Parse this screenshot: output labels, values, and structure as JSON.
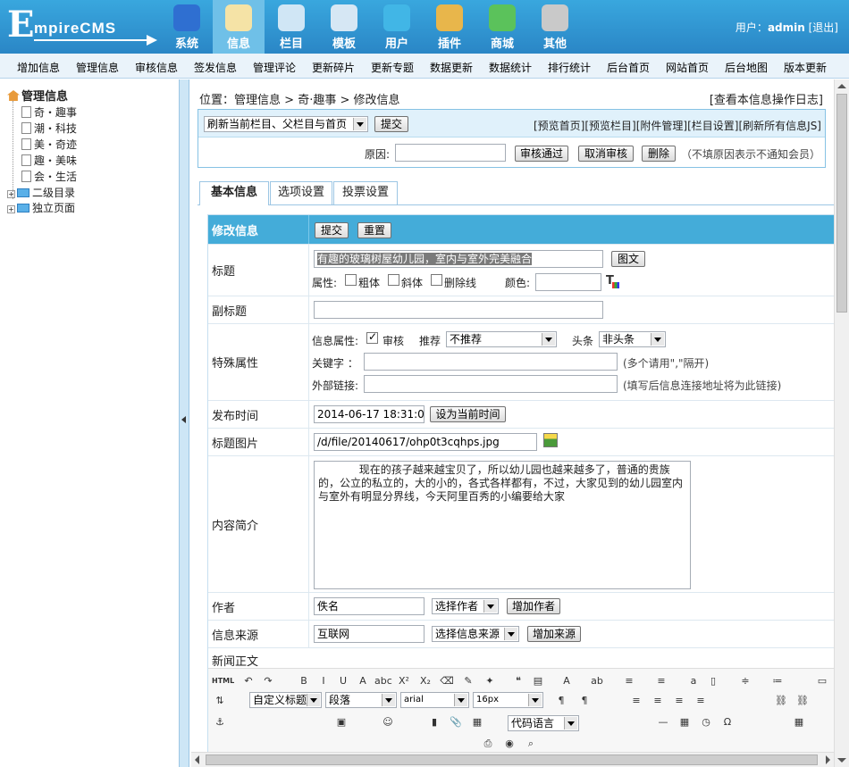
{
  "logo": {
    "big": "E",
    "rest": "mpireCMS"
  },
  "nav": [
    {
      "label": "系统",
      "icon": "globe-icon",
      "color": "#2f6fd1"
    },
    {
      "label": "信息",
      "icon": "edit-document-icon",
      "color": "#f5e3a6",
      "active": true
    },
    {
      "label": "栏目",
      "icon": "folder-icon",
      "color": "#d0e6f5"
    },
    {
      "label": "模板",
      "icon": "template-window-icon",
      "color": "#d6e7f4"
    },
    {
      "label": "用户",
      "icon": "user-icon",
      "color": "#41b6e6"
    },
    {
      "label": "插件",
      "icon": "tools-icon",
      "color": "#e8b64b"
    },
    {
      "label": "商城",
      "icon": "credit-card-icon",
      "color": "#5bc25b"
    },
    {
      "label": "其他",
      "icon": "gear-icon",
      "color": "#c9c9c9"
    }
  ],
  "user": {
    "prefix": "用户：",
    "name": "admin",
    "logout": "[退出]"
  },
  "menu": [
    "增加信息",
    "管理信息",
    "审核信息",
    "签发信息",
    "管理评论",
    "更新碎片",
    "更新专题",
    "数据更新",
    "数据统计",
    "排行统计",
    "后台首页",
    "网站首页",
    "后台地图",
    "版本更新"
  ],
  "tree": {
    "root": "管理信息",
    "items": [
      "奇・趣事",
      "潮・科技",
      "美・奇迹",
      "趣・美味",
      "会・生活"
    ],
    "folders": [
      "二级目录",
      "独立页面"
    ]
  },
  "breadcrumb": {
    "prefix": "位置：",
    "a": "管理信息",
    "sep1": " > ",
    "b": "奇·趣事",
    "sep2": " > ",
    "c": "修改信息"
  },
  "log_link": "[查看本信息操作日志]",
  "refresh_select": "刷新当前栏目、父栏目与首页",
  "submit_btn": "提交",
  "top_links": [
    "[预览首页]",
    "[预览栏目]",
    "[附件管理]",
    "[栏目设置]",
    "[刷新所有信息JS]"
  ],
  "reason_label": "原因:",
  "audit_buttons": [
    "审核通过",
    "取消审核",
    "删除"
  ],
  "reason_note": "（不填原因表示不通知会员）",
  "tabs": [
    "基本信息",
    "选项设置",
    "投票设置"
  ],
  "form": {
    "head_label": "修改信息",
    "head_submit": "提交",
    "head_reset": "重置",
    "title_label": "标题",
    "title_value": "有趣的玻璃树屋幼儿园，室内与室外完美融合",
    "tuwen_btn": "图文",
    "attr_label": "属性:",
    "bold": "粗体",
    "italic": "斜体",
    "strike": "删除线",
    "color_label": "颜色:",
    "subtitle_label": "副标题",
    "special_label": "特殊属性",
    "info_attr": "信息属性:",
    "audit": "审核",
    "recommend": "推荐",
    "recommend_value": "不推荐",
    "headline": "头条",
    "headline_value": "非头条",
    "keyword_label": "关键字 ：",
    "keyword_note": "(多个请用\",\"隔开)",
    "extlink_label": "外部链接:",
    "extlink_note": "(填写后信息连接地址将为此链接)",
    "pubtime_label": "发布时间",
    "pubtime_value": "2014-06-17 18:31:04",
    "pubtime_btn": "设为当前时间",
    "titlepic_label": "标题图片",
    "titlepic_value": "/d/file/20140617/ohp0t3cqhps.jpg",
    "summary_label": "内容简介",
    "summary_value": "            现在的孩子越来越宝贝了，所以幼儿园也越来越多了，普通的贵族的，公立的私立的，大的小的，各式各样都有，不过，大家见到的幼儿园室内与室外有明显分界线，今天阿里百秀的小编要给大家",
    "author_label": "作者",
    "author_value": "佚名",
    "author_select": "选择作者",
    "author_add": "增加作者",
    "source_label": "信息来源",
    "source_value": "互联网",
    "source_select": "选择信息来源",
    "source_add": "增加来源",
    "body_label": "新闻正文"
  },
  "editor": {
    "html": "HTML",
    "heading": "自定义标题",
    "paragraph": "段落",
    "font": "arial",
    "size": "16px",
    "code": "代码语言"
  }
}
